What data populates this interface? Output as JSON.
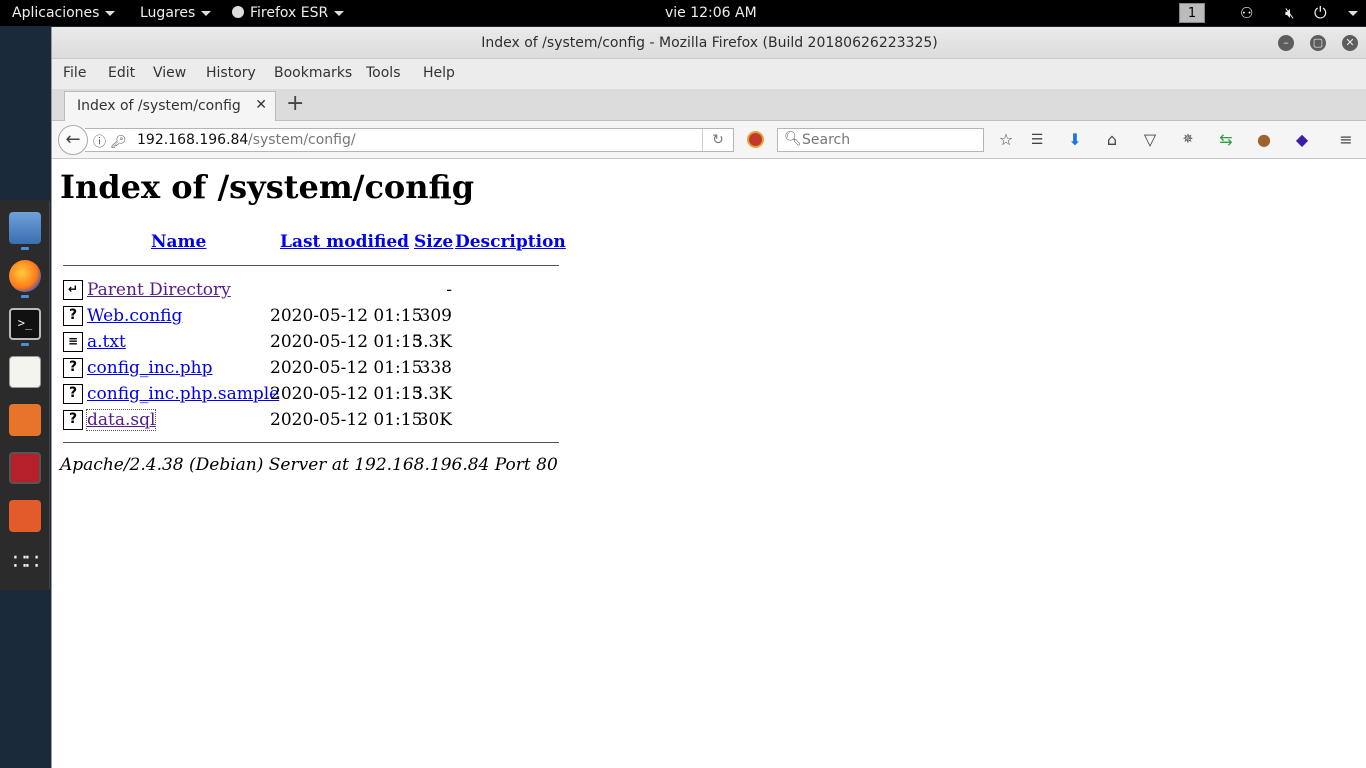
{
  "topbar": {
    "apps_menu": "Aplicaciones",
    "places_menu": "Lugares",
    "app_menu": "Firefox ESR",
    "clock": "vie 12:06 AM",
    "workspace": "1"
  },
  "window": {
    "title": "Index of /system/config - Mozilla Firefox (Build 20180626223325)"
  },
  "menubar": {
    "items": [
      "File",
      "Edit",
      "View",
      "History",
      "Bookmarks",
      "Tools",
      "Help"
    ]
  },
  "tab": {
    "title": "Index of /system/config",
    "close": "✕",
    "new": "+"
  },
  "navbar": {
    "url_host": "192.168.196.84",
    "url_path": "/system/config/",
    "search_placeholder": "Search"
  },
  "page": {
    "title": "Index of /system/config",
    "columns": [
      "Name",
      "Last modified",
      "Size",
      "Description"
    ],
    "rows": [
      {
        "icon": "back",
        "name": "Parent Directory",
        "modified": "",
        "size": "-",
        "visited": true
      },
      {
        "icon": "unknown",
        "name": "Web.config",
        "modified": "2020-05-12 01:15",
        "size": "309",
        "visited": false
      },
      {
        "icon": "text",
        "name": "a.txt",
        "modified": "2020-05-12 01:15",
        "size": "3.3K",
        "visited": false
      },
      {
        "icon": "unknown",
        "name": "config_inc.php",
        "modified": "2020-05-12 01:15",
        "size": "338",
        "visited": false
      },
      {
        "icon": "unknown",
        "name": "config_inc.php.sample",
        "modified": "2020-05-12 01:15",
        "size": "3.3K",
        "visited": false
      },
      {
        "icon": "unknown",
        "name": "data.sql",
        "modified": "2020-05-12 01:15",
        "size": "30K",
        "visited": true
      }
    ],
    "footer": "Apache/2.4.38 (Debian) Server at 192.168.196.84 Port 80"
  },
  "colors": {
    "link": "#0000ee",
    "visited": "#551a8b",
    "topbar": "#000000"
  },
  "dock_icons": [
    "files-icon",
    "firefox-icon",
    "terminal-icon",
    "text-editor-icon",
    "burpsuite-icon",
    "metasploit-icon",
    "zap-icon",
    "app-grid-icon"
  ]
}
